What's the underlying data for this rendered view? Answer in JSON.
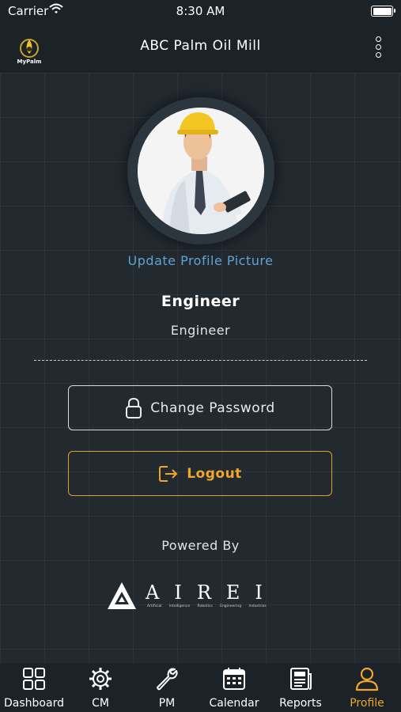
{
  "status_bar": {
    "carrier": "Carrier",
    "time": "8:30 AM",
    "battery_level": 1.0
  },
  "header": {
    "logo_text": "MyPalm",
    "title": "ABC Palm Oil Mill",
    "menu_icon": "kebab-icon"
  },
  "profile": {
    "update_picture_label": "Update Profile Picture",
    "name": "Engineer",
    "role": "Engineer"
  },
  "actions": {
    "change_password_label": "Change Password",
    "change_password_icon": "lock-icon",
    "logout_label": "Logout",
    "logout_icon": "logout-icon"
  },
  "footer": {
    "powered_by": "Powered By",
    "brand": "AIREI",
    "brand_tagline": "Artificial Intelligence Robotics Engineering Industries"
  },
  "tabs": [
    {
      "label": "Dashboard",
      "icon": "grid-icon",
      "active": false
    },
    {
      "label": "CM",
      "icon": "gear-icon",
      "active": false
    },
    {
      "label": "PM",
      "icon": "wrench-icon",
      "active": false
    },
    {
      "label": "Calendar",
      "icon": "calendar-icon",
      "active": false
    },
    {
      "label": "Reports",
      "icon": "newspaper-icon",
      "active": false
    },
    {
      "label": "Profile",
      "icon": "person-icon",
      "active": true
    }
  ],
  "colors": {
    "accent": "#f0a628",
    "link": "#5fa3d6",
    "background": "#222a30"
  }
}
